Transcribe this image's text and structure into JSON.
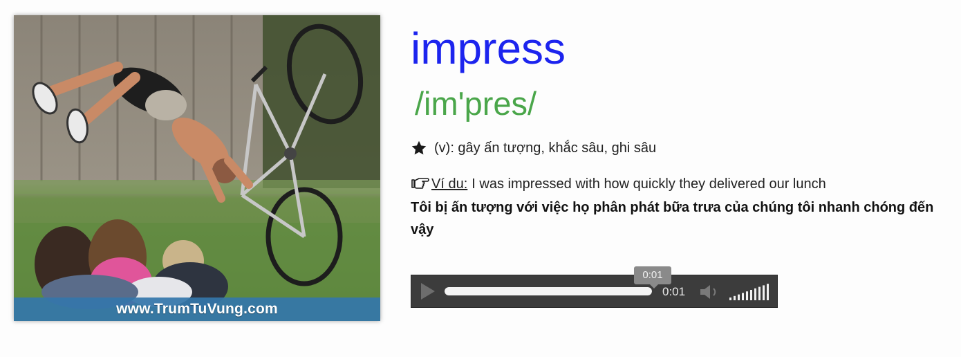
{
  "illustration": {
    "watermark": "www.TrumTuVung.com"
  },
  "entry": {
    "word": "impress",
    "phonetic": "/im'pres/",
    "meaning": "(v): gây ấn tượng, khắc sâu, ghi sâu",
    "example_label": "Ví du:",
    "example_text": "I was impressed with how quickly they delivered our lunch",
    "translation": "Tôi bị ấn tượng với việc họ phân phát bữa trưa của chúng tôi nhanh chóng đến vậy"
  },
  "player": {
    "current_time": "0:01",
    "tooltip_time": "0:01",
    "progress": 1.0,
    "volume_level": 1.0
  },
  "colors": {
    "word": "#1c24ee",
    "phonetic": "#4aa64a",
    "watermark_bar": "#3476aa",
    "player_bg": "#3c3c3c"
  },
  "icons": {
    "star": "star-icon",
    "hand": "pointing-hand-icon",
    "play": "play-icon",
    "mute": "speaker-icon",
    "volume": "volume-bars-icon"
  }
}
